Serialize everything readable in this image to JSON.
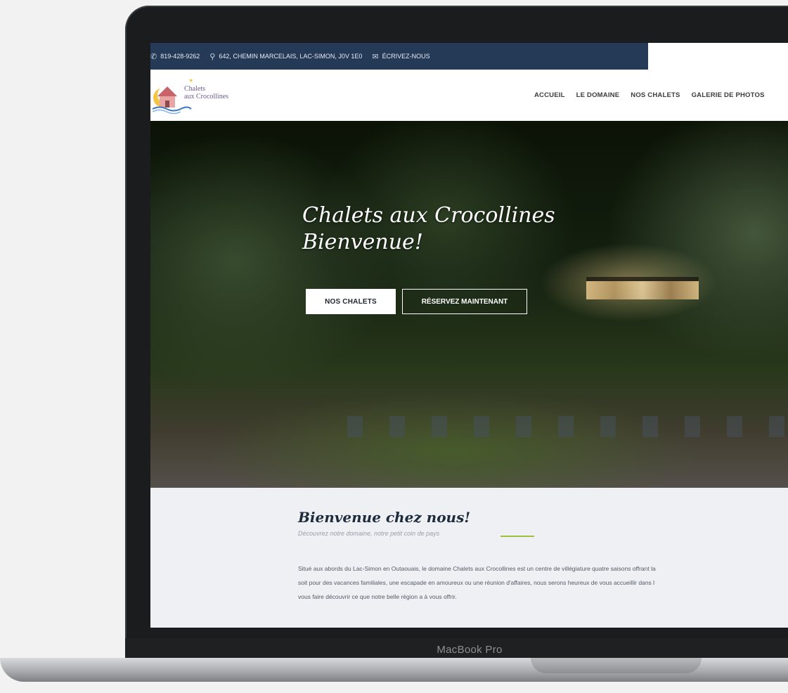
{
  "topbar": {
    "phone": "819-428-9262",
    "address": "642, CHEMIN MARCELAIS, LAC-SIMON, J0V 1E0",
    "email_label": "ÉCRIVEZ-NOUS"
  },
  "logo": {
    "line1": "Chalets",
    "line2": "aux Crocollines"
  },
  "nav": {
    "items": [
      "ACCUEIL",
      "LE DOMAINE",
      "NOS CHALETS",
      "GALERIE DE PHOTOS"
    ]
  },
  "hero": {
    "title_line1": "Chalets aux Crocollines",
    "title_line2": "Bienvenue!",
    "primary_button": "NOS CHALETS",
    "secondary_button": "RÉSERVEZ MAINTENANT"
  },
  "welcome": {
    "title": "Bienvenue chez nous!",
    "subtitle": "Découvrez notre domaine, notre petit coin de pays",
    "body_line1": "Situé aux abords du Lac-Simon en Outaouais, le domaine Chalets aux Crocollines est un centre de villégiature quatre saisons offrant la",
    "body_line2": "soit pour des vacances familiales, une escapade en amoureux ou une réunion d'affaires, nous serons heureux de vous accueillir dans l",
    "body_line3": "vous faire découvrir ce que notre belle région a à vous offrir."
  },
  "device": {
    "label": "MacBook Pro"
  },
  "colors": {
    "topbar_bg": "#253a57",
    "accent_green": "#9cc23c"
  }
}
